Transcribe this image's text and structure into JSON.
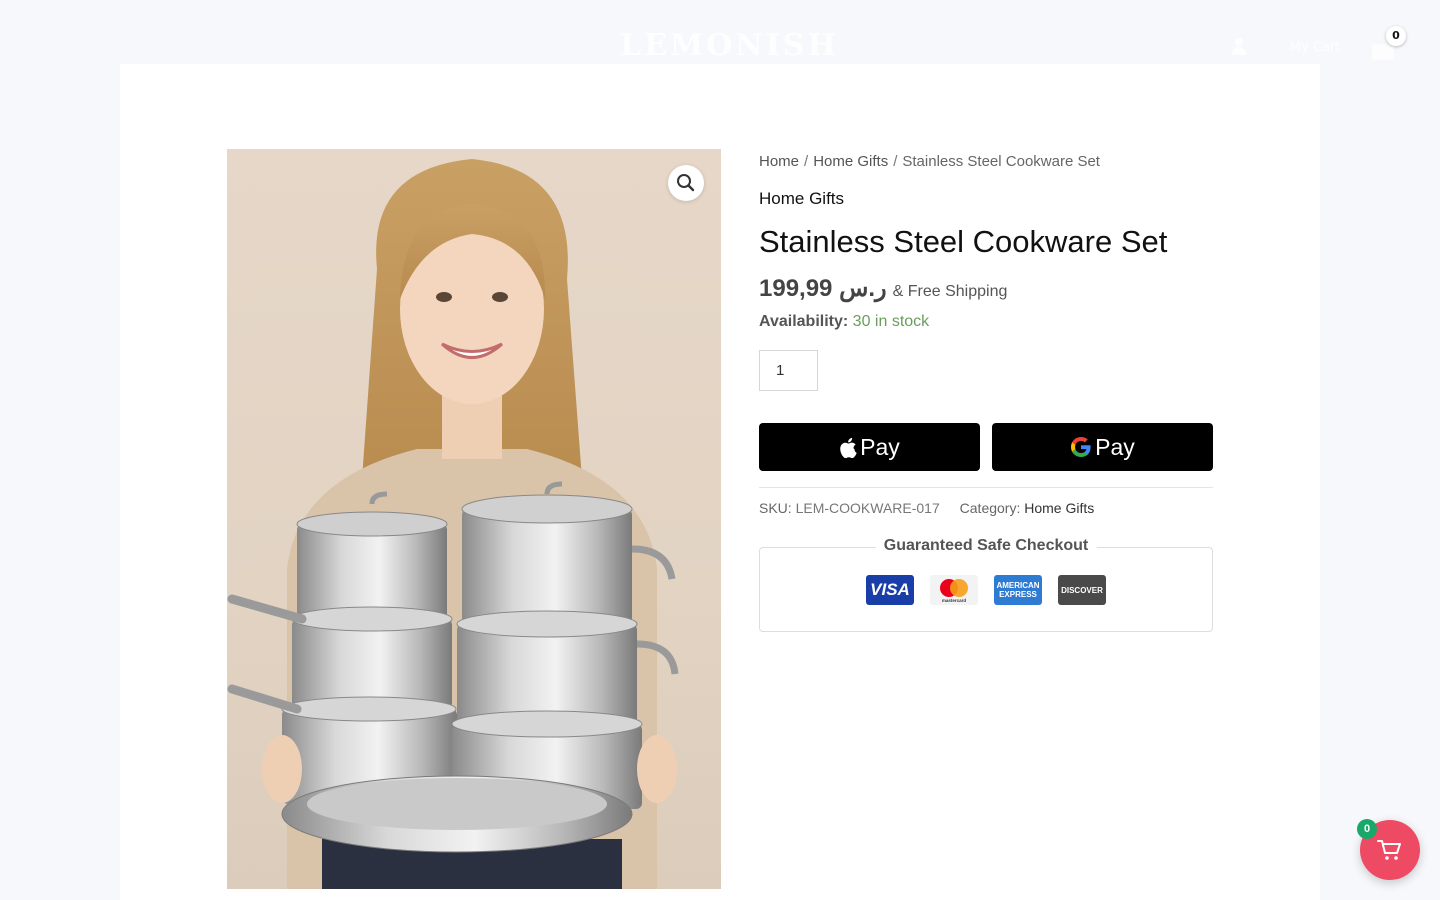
{
  "header": {
    "logo_text": "LEMONISH",
    "cart_label": "My Cart",
    "cart_count": "0"
  },
  "breadcrumb": {
    "home": "Home",
    "category": "Home Gifts",
    "current": "Stainless Steel Cookware Set",
    "separator": "/"
  },
  "product": {
    "category": "Home Gifts",
    "title": "Stainless Steel Cookware Set",
    "price": "ر.س 199,99",
    "shipping": "& Free Shipping",
    "availability_label": "Availability:",
    "availability_value": "30 in stock",
    "quantity": "1",
    "sku_label": "SKU:",
    "sku": "LEM-COOKWARE-017",
    "category_label": "Category:",
    "category_link": "Home Gifts"
  },
  "payments": {
    "apple_pay": "Pay",
    "google_pay": "Pay"
  },
  "secure_checkout": {
    "title": "Guaranteed Safe Checkout",
    "cards": [
      "VISA",
      "mastercard",
      "AMERICAN EXPRESS",
      "DISCOVER"
    ]
  },
  "floating_cart": {
    "count": "0"
  },
  "colors": {
    "in_stock": "#6a9d5c",
    "floating_cart": "#ef4a63",
    "cart_badge": "#1aa86a",
    "pay_button": "#000000"
  }
}
